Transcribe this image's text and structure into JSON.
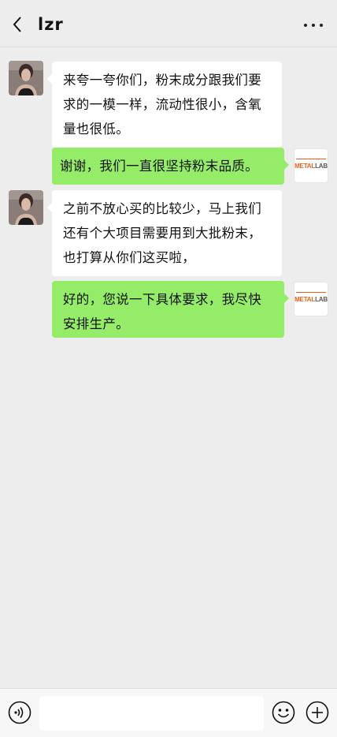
{
  "header": {
    "title": "lzr"
  },
  "messages": [
    {
      "direction": "in",
      "text": "来夸一夸你们，粉末成分跟我们要求的一模一样，流动性很小，含氧量也很低。"
    },
    {
      "direction": "out",
      "text": "谢谢，我们一直很坚持粉末品质。"
    },
    {
      "direction": "in",
      "text": "之前不放心买的比较少，马上我们还有个大项目需要用到大批粉末，也打算从你们这买啦，"
    },
    {
      "direction": "out",
      "text": "好的，您说一下具体要求，我尽快安排生产。"
    }
  ],
  "avatar_logo": {
    "part1": "METAL",
    "part2": "LAB"
  },
  "input": {
    "value": ""
  },
  "colors": {
    "background": "#ededed",
    "incoming_bubble": "#ffffff",
    "outgoing_bubble": "#95ec69",
    "logo_accent": "#e8601c"
  },
  "icons": [
    "back-arrow-icon",
    "more-dots-icon",
    "voice-icon",
    "emoji-icon",
    "plus-icon"
  ]
}
